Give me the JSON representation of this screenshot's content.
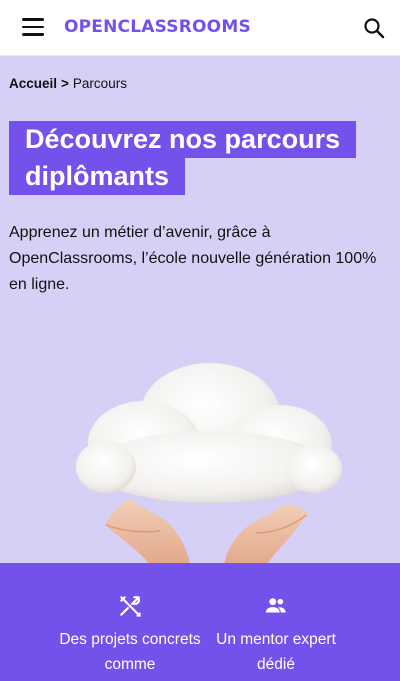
{
  "header": {
    "logo_text": "OPENCLASSROOMS",
    "menu_icon": "hamburger-menu-icon",
    "search_icon": "search-icon"
  },
  "breadcrumb": {
    "home": "Accueil",
    "separator": ">",
    "current": "Parcours"
  },
  "hero": {
    "title_line1": "Découvrez nos parcours",
    "title_line2": "diplômants",
    "subtitle": "Apprenez un métier d’avenir, grâce à OpenClassrooms, l’école nouvelle génération 100% en ligne.",
    "image_icon": "cloud-in-hands-illustration"
  },
  "features": [
    {
      "icon": "tools-icon",
      "label": "Des projets concrets comme"
    },
    {
      "icon": "people-icon",
      "label": "Un mentor expert dédié"
    }
  ],
  "colors": {
    "brand_purple": "#7451eb",
    "background_lavender": "#d6d0f7"
  }
}
